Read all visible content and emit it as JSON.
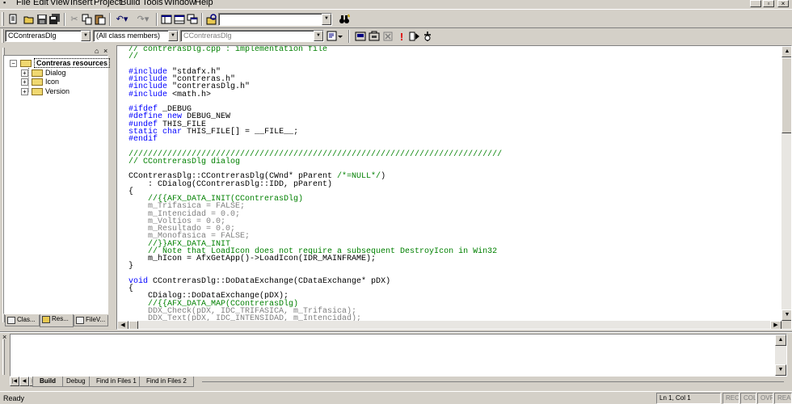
{
  "menu": {
    "items": [
      "File",
      "Edit",
      "View",
      "Insert",
      "Project",
      "Build",
      "Tools",
      "Window",
      "Help"
    ]
  },
  "toolbar": {
    "find_combo_value": "",
    "icons": [
      "new-text-file-icon",
      "open-folder-icon",
      "save-icon",
      "save-all-icon",
      "cut-icon",
      "copy-icon",
      "paste-icon",
      "undo-icon",
      "redo-icon",
      "workspace-window-icon",
      "output-window-icon",
      "windows-list-icon",
      "find-in-files-icon",
      "find-icon"
    ]
  },
  "wizardbar": {
    "class_combo": "CContrerasDlg",
    "filter_combo": "(All class members)",
    "members_combo": "CContrerasDlg",
    "action_icons": [
      "wizardbar-actions-icon",
      "compile-icon",
      "build-icon",
      "stop-build-icon",
      "execute-icon",
      "go-icon",
      "insert-breakpoint-icon"
    ]
  },
  "workspace": {
    "root_label": "Contreras resources",
    "items": [
      {
        "label": "Dialog"
      },
      {
        "label": "Icon"
      },
      {
        "label": "Version"
      }
    ],
    "tabs": [
      {
        "label": "Clas..."
      },
      {
        "label": "Res..."
      },
      {
        "label": "FileV..."
      }
    ]
  },
  "editor": {
    "lines": [
      [
        [
          "c",
          "// contrerasDlg.cpp : implementation file"
        ]
      ],
      [
        [
          "c",
          "//"
        ]
      ],
      [],
      [
        [
          "k",
          "#include"
        ],
        [
          "t",
          " \"stdafx.h\""
        ]
      ],
      [
        [
          "k",
          "#include"
        ],
        [
          "t",
          " \"contreras.h\""
        ]
      ],
      [
        [
          "k",
          "#include"
        ],
        [
          "t",
          " \"contrerasDlg.h\""
        ]
      ],
      [
        [
          "k",
          "#include"
        ],
        [
          "t",
          " <math.h>"
        ]
      ],
      [],
      [
        [
          "k",
          "#ifdef"
        ],
        [
          "t",
          " _DEBUG"
        ]
      ],
      [
        [
          "k",
          "#define"
        ],
        [
          "t",
          " "
        ],
        [
          "k",
          "new"
        ],
        [
          "t",
          " DEBUG_NEW"
        ]
      ],
      [
        [
          "k",
          "#undef"
        ],
        [
          "t",
          " THIS_FILE"
        ]
      ],
      [
        [
          "k",
          "static"
        ],
        [
          "t",
          " "
        ],
        [
          "k",
          "char"
        ],
        [
          "t",
          " THIS_FILE[] = __FILE__;"
        ]
      ],
      [
        [
          "k",
          "#endif"
        ]
      ],
      [],
      [
        [
          "c",
          "/////////////////////////////////////////////////////////////////////////////"
        ]
      ],
      [
        [
          "c",
          "// CContrerasDlg dialog"
        ]
      ],
      [],
      [
        [
          "t",
          "CContrerasDlg::CContrerasDlg(CWnd* pParent "
        ],
        [
          "c",
          "/*=NULL*/"
        ],
        [
          "t",
          ")"
        ]
      ],
      [
        [
          "t",
          "\t: CDialog(CContrerasDlg::IDD, pParent)"
        ]
      ],
      [
        [
          "t",
          "{"
        ]
      ],
      [
        [
          "c",
          "\t//{{AFX_DATA_INIT(CContrerasDlg)"
        ]
      ],
      [
        [
          "g",
          "\tm_Trifasica = FALSE;"
        ]
      ],
      [
        [
          "g",
          "\tm_Intencidad = 0.0;"
        ]
      ],
      [
        [
          "g",
          "\tm_Voltios = 0.0;"
        ]
      ],
      [
        [
          "g",
          "\tm_Resultado = 0.0;"
        ]
      ],
      [
        [
          "g",
          "\tm_Monofasica = FALSE;"
        ]
      ],
      [
        [
          "c",
          "\t//}}AFX_DATA_INIT"
        ]
      ],
      [
        [
          "c",
          "\t// Note that LoadIcon does not require a subsequent DestroyIcon in Win32"
        ]
      ],
      [
        [
          "t",
          "\tm_hIcon = AfxGetApp()->LoadIcon(IDR_MAINFRAME);"
        ]
      ],
      [
        [
          "t",
          "}"
        ]
      ],
      [],
      [
        [
          "k",
          "void"
        ],
        [
          "t",
          " CContrerasDlg::DoDataExchange(CDataExchange* pDX)"
        ]
      ],
      [
        [
          "t",
          "{"
        ]
      ],
      [
        [
          "t",
          "\tCDialog::DoDataExchange(pDX);"
        ]
      ],
      [
        [
          "c",
          "\t//{{AFX_DATA_MAP(CContrerasDlg)"
        ]
      ],
      [
        [
          "g",
          "\tDDX_Check(pDX, IDC_TRIFASICA, m_Trifasica);"
        ]
      ],
      [
        [
          "g",
          "\tDDX_Text(pDX, IDC_INTENSIDAD, m_Intencidad);"
        ]
      ]
    ]
  },
  "output": {
    "tabs": [
      {
        "label": "Build"
      },
      {
        "label": "Debug"
      },
      {
        "label": "Find in Files 1"
      },
      {
        "label": "Find in Files 2"
      }
    ]
  },
  "status": {
    "ready": "Ready",
    "position": "Ln 1, Col 1",
    "indicators": [
      "REC",
      "COL",
      "OVR",
      "READ"
    ]
  }
}
